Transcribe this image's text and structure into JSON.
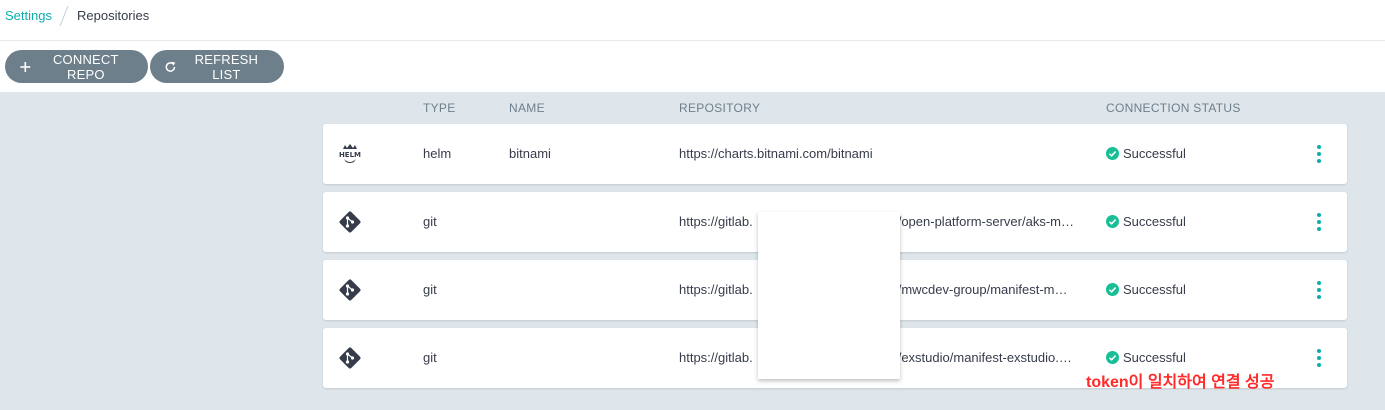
{
  "breadcrumb": {
    "settings": "Settings",
    "current": "Repositories"
  },
  "toolbar": {
    "connect_label": "CONNECT REPO",
    "refresh_label": "REFRESH LIST"
  },
  "table": {
    "headers": {
      "type": "TYPE",
      "name": "NAME",
      "repository": "REPOSITORY",
      "status": "CONNECTION STATUS"
    },
    "rows": [
      {
        "icon": "helm-icon",
        "icon_text": "HELM",
        "type": "helm",
        "name": "bitnami",
        "repository": "https://charts.bitnami.com/bitnami",
        "status": "Successful"
      },
      {
        "icon": "git-icon",
        "type": "git",
        "name": "",
        "repository": "https://gitlab.",
        "repository_tail": "/open-platform-server/aks-m…",
        "status": "Successful"
      },
      {
        "icon": "git-icon",
        "type": "git",
        "name": "",
        "repository": "https://gitlab.",
        "repository_tail": "/mwcdev-group/manifest-m…",
        "status": "Successful"
      },
      {
        "icon": "git-icon",
        "type": "git",
        "name": "",
        "repository": "https://gitlab.",
        "repository_tail": "/exstudio/manifest-exstudio.…",
        "status": "Successful"
      }
    ]
  },
  "annotation": "token이 일치하여 연결 성공",
  "colors": {
    "accent": "#0dadae",
    "success": "#18be94",
    "button": "#6d7f8b",
    "annotation": "#ff2a2a"
  }
}
